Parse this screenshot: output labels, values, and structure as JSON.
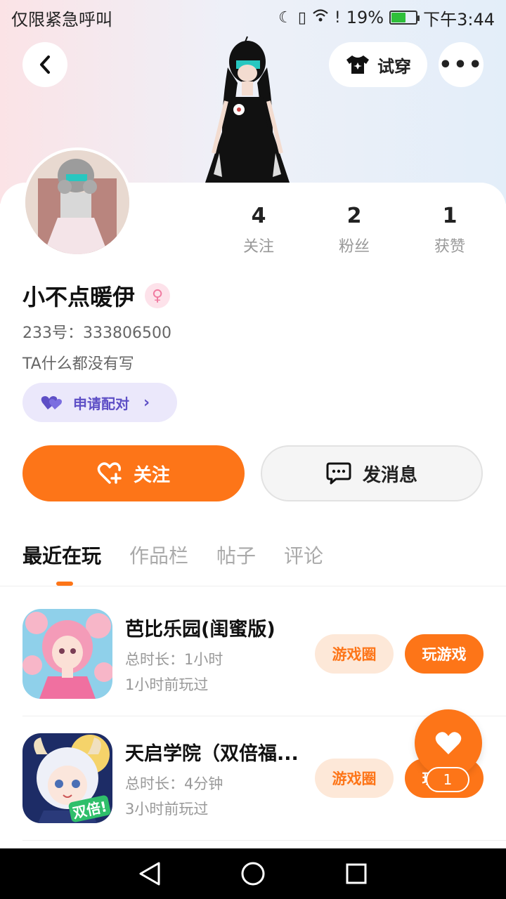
{
  "status_bar": {
    "left_text": "仅限紧急呼叫",
    "battery": "19%",
    "time": "下午3:44"
  },
  "header": {
    "tryon_label": "试穿",
    "more_label": "•••"
  },
  "profile": {
    "username": "小不点暖伊",
    "gender_symbol": "♀",
    "uid_label": "233号：",
    "uid": "333806500",
    "bio": "TA什么都没有写",
    "pair_label": "申请配对"
  },
  "stats": [
    {
      "num": "4",
      "label": "关注"
    },
    {
      "num": "2",
      "label": "粉丝"
    },
    {
      "num": "1",
      "label": "获赞"
    }
  ],
  "actions": {
    "follow_label": "关注",
    "message_label": "发消息"
  },
  "tabs": [
    "最近在玩",
    "作品栏",
    "帖子",
    "评论"
  ],
  "games": [
    {
      "title": "芭比乐园(闺蜜版)",
      "duration": "总时长：1小时",
      "last_played": "1小时前玩过",
      "circle_label": "游戏圈",
      "play_label": "玩游戏"
    },
    {
      "title": "天启学院（双倍福...",
      "duration": "总时长：4分钟",
      "last_played": "3小时前玩过",
      "circle_label": "游戏圈",
      "play_label": "玩游戏",
      "icon_badge": "双倍!"
    }
  ],
  "float_like": {
    "count": "1"
  },
  "colors": {
    "accent": "#fd7518",
    "pair_purple": "#5e4fc6",
    "pair_bg": "#ebe8fb",
    "chip_bg": "#fde8d8"
  }
}
